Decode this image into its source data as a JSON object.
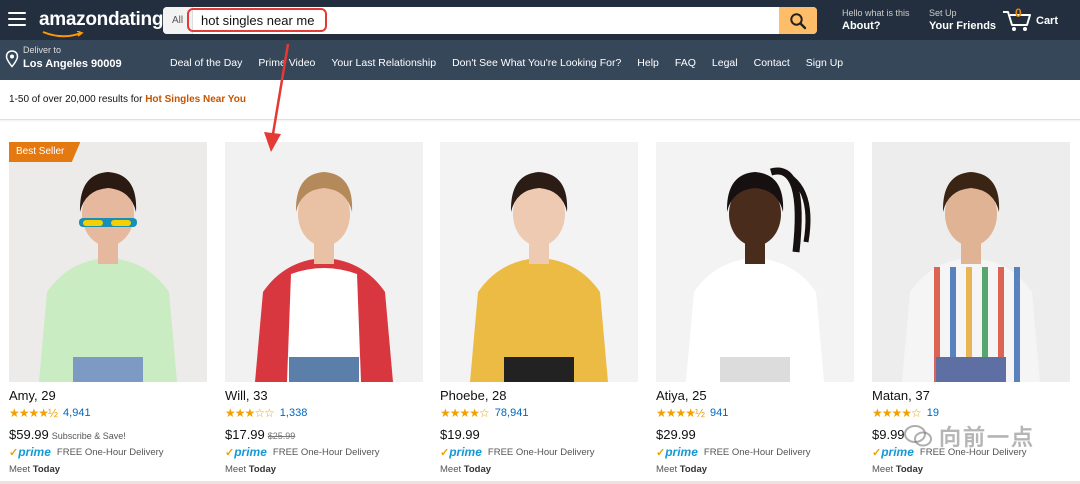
{
  "header": {
    "logo": "amazondating",
    "search": {
      "category": "All",
      "value": "hot singles near me"
    },
    "account": {
      "hello": "Hello what is this",
      "link": "About?"
    },
    "setup": {
      "small": "Set Up",
      "link": "Your Friends"
    },
    "cart": {
      "count": "0",
      "label": "Cart"
    }
  },
  "subnav": {
    "deliver_small": "Deliver to",
    "deliver_big": "Los Angeles 90009",
    "items": [
      "Deal of the Day",
      "Prime Video",
      "Your Last Relationship",
      "Don't See What You're Looking For?",
      "Help",
      "FAQ",
      "Legal",
      "Contact",
      "Sign Up"
    ]
  },
  "results": {
    "prefix": "1-50 of over 20,000 results for ",
    "query": "Hot Singles Near You"
  },
  "products": [
    {
      "badge": "Best Seller",
      "name": "Amy, 29",
      "stars": "★★★★½",
      "rating": 4.5,
      "reviews": "4,941",
      "price": "$59.99",
      "old_price": "",
      "note": "Subscribe & Save!",
      "prime": "prime",
      "delivery": "FREE One-Hour Delivery",
      "meet_label": "Meet",
      "meet_when": "Today",
      "colors": {
        "bg": "#ecebe9",
        "top": "#c9ecc2",
        "hair": "#2a1a12",
        "skin": "#e6b89d",
        "bottom": "#7c9ac4"
      }
    },
    {
      "badge": "",
      "name": "Will, 33",
      "stars": "★★★☆☆",
      "rating": 3,
      "reviews": "1,338",
      "price": "$17.99",
      "old_price": "$25.99",
      "note": "",
      "prime": "prime",
      "delivery": "FREE One-Hour Delivery",
      "meet_label": "Meet",
      "meet_when": "Today",
      "colors": {
        "bg": "#f1f1f1",
        "top": "#ffffff",
        "sleeve": "#d9373f",
        "hair": "#b58a5a",
        "skin": "#e9c1a4",
        "bottom": "#5b7fa8"
      }
    },
    {
      "badge": "",
      "name": "Phoebe, 28",
      "stars": "★★★★☆",
      "rating": 4,
      "reviews": "78,941",
      "price": "$19.99",
      "old_price": "",
      "note": "",
      "prime": "prime",
      "delivery": "FREE One-Hour Delivery",
      "meet_label": "Meet",
      "meet_when": "Today",
      "colors": {
        "bg": "#f3f3f3",
        "top": "#ecbb44",
        "hair": "#2b1d16",
        "skin": "#efcab2",
        "bottom": "#222222"
      }
    },
    {
      "badge": "",
      "name": "Atiya, 25",
      "stars": "★★★★½",
      "rating": 4.5,
      "reviews": "941",
      "price": "$29.99",
      "old_price": "",
      "note": "",
      "prime": "prime",
      "delivery": "FREE One-Hour Delivery",
      "meet_label": "Meet",
      "meet_when": "Today",
      "colors": {
        "bg": "#f3f3f3",
        "top": "#ffffff",
        "hair": "#161010",
        "skin": "#4a2c1d",
        "bottom": "#dcdcdc"
      }
    },
    {
      "badge": "",
      "name": "Matan, 37",
      "stars": "★★★★☆",
      "rating": 4,
      "reviews": "19",
      "price": "$9.99",
      "old_price": "",
      "note": "",
      "prime": "prime",
      "delivery": "FREE One-Hour Delivery",
      "meet_label": "Meet",
      "meet_when": "Today",
      "colors": {
        "bg": "#ededed",
        "top": "#f5f5f5",
        "hair": "#3a2414",
        "skin": "#e0b394",
        "bottom": "#5d6fa3"
      }
    }
  ],
  "watermark": "向前一点",
  "theme": {
    "nav_dark": "#232f3e",
    "nav_mid": "#37475a",
    "search_btn": "#febd69",
    "accent_orange": "#e47911",
    "link_blue": "#0066c0",
    "highlight_red": "#e53935"
  }
}
